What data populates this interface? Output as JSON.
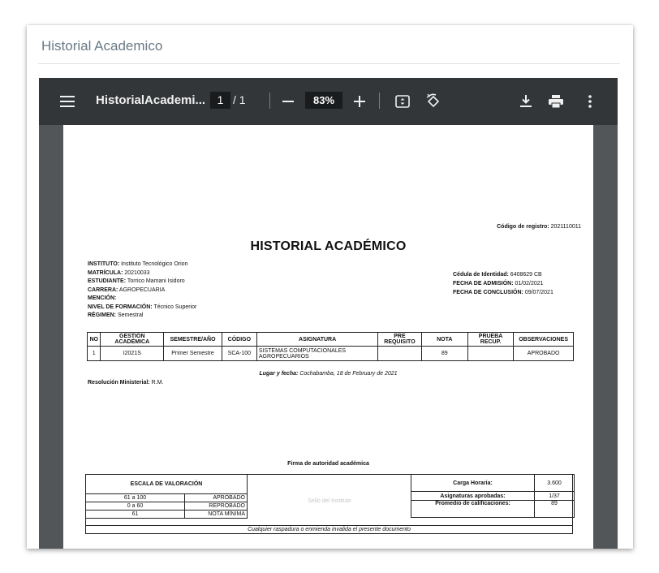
{
  "card": {
    "title": "Historial Academico"
  },
  "viewer": {
    "doc_title": "HistorialAcademi...",
    "page_current": "1",
    "page_total": "/ 1",
    "zoom": "83%",
    "icons": [
      "menu-icon",
      "zoom-out-icon",
      "zoom-in-icon",
      "fit-page-icon",
      "rotate-icon",
      "download-icon",
      "print-icon",
      "more-vert-icon"
    ]
  },
  "doc": {
    "registro_label": "Código de registro:",
    "registro_value": "2021110011",
    "heading": "HISTORIAL ACADÉMICO",
    "left_info": [
      {
        "label": "INSTITUTO:",
        "value": "Instituto Tecnológico Orion"
      },
      {
        "label": "MATRÍCULA:",
        "value": "20210033"
      },
      {
        "label": "ESTUDIANTE:",
        "value": "Torrico  Mamani Isidoro"
      },
      {
        "label": "CARRERA:",
        "value": "AGROPECUARIA"
      },
      {
        "label": "MENCIÓN:",
        "value": ""
      },
      {
        "label": "NIVEL DE FORMACIÓN:",
        "value": "Técnico Superior"
      },
      {
        "label": "RÉGIMEN:",
        "value": "Semestral"
      }
    ],
    "right_info": [
      {
        "label": "Cédula de Identidad:",
        "value": "6408629 CB"
      },
      {
        "label": "FECHA DE ADMISIÓN:",
        "value": "01/02/2021"
      },
      {
        "label": "FECHA DE CONCLUSIÓN:",
        "value": "09/07/2021"
      }
    ],
    "table_headers": [
      "NO",
      "GESTIÓN ACADÉMICA",
      "SEMESTRE/AÑO",
      "CÓDIGO",
      "ASIGNATURA",
      "PRE REQUISITO",
      "NOTA",
      "PRUEBA RECUP.",
      "OBSERVACIONES"
    ],
    "table_rows": [
      [
        "1",
        "I2021S",
        "Primer Semestre",
        "SCA-100",
        "SISTEMAS COMPUTACIONALES AGROPECUARIOS",
        "",
        "89",
        "",
        "APROBADO"
      ]
    ],
    "lugar_label": "Lugar y fecha:",
    "lugar_value": "Cochabamba, 18 de February de 2021",
    "resolucion_label": "Resolución Ministerial:",
    "resolucion_value": "R.M.",
    "firma": "Firma de autoridad académica",
    "sello": "Sello del Instituto",
    "escala_title": "ESCALA DE VALORACIÓN",
    "escala_rows": [
      [
        "61 a 100",
        "APROBADO"
      ],
      [
        "0 a 60",
        "REPROBADO"
      ],
      [
        "61",
        "NOTA MÍNIMA"
      ]
    ],
    "stats": [
      {
        "label": "Carga Horaria:",
        "value": "3.600"
      },
      {
        "label": "Asignaturas aprobadas:",
        "value": "1/37"
      },
      {
        "label": "Promedio de calificaciones:",
        "value": "89"
      }
    ],
    "footer": "Cualquier raspadura o enmienda invalida el presente documento"
  }
}
